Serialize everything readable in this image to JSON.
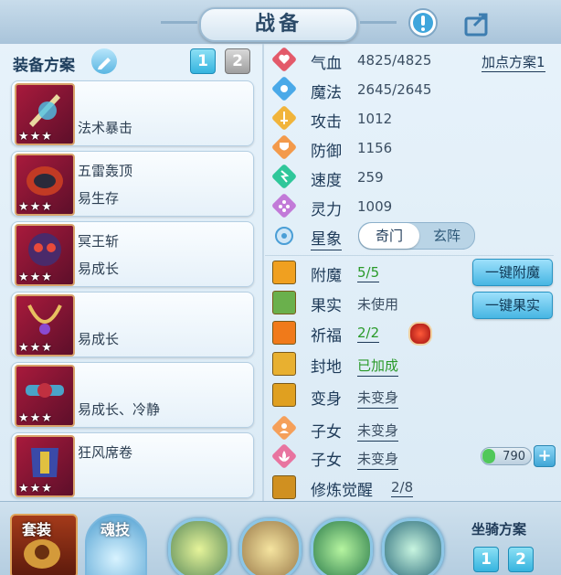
{
  "window": {
    "title": "战备"
  },
  "equipment": {
    "plan_label": "装备方案",
    "plan_buttons": [
      "1",
      "2"
    ],
    "items": [
      {
        "line1": "",
        "line2": "法术暴击",
        "stars": "★★★"
      },
      {
        "line1": "五雷轰顶",
        "line2": "易生存",
        "stars": "★★★"
      },
      {
        "line1": "冥王斩",
        "line2": "易成长",
        "stars": "★★★"
      },
      {
        "line1": "",
        "line2": "易成长",
        "stars": "★★★"
      },
      {
        "line1": "",
        "line2": "易成长、冷静",
        "stars": "★★★"
      },
      {
        "line1": "狂风席卷",
        "line2": "",
        "stars": "★★★"
      }
    ]
  },
  "stats": {
    "points_plan": "加点方案1",
    "items": [
      {
        "label": "气血",
        "value": "4825/4825",
        "icon": "heart-icon",
        "color": "#e35a6a"
      },
      {
        "label": "魔法",
        "value": "2645/2645",
        "icon": "mana-icon",
        "color": "#4aa9e8"
      },
      {
        "label": "攻击",
        "value": "1012",
        "icon": "sword-icon",
        "color": "#f1b43b"
      },
      {
        "label": "防御",
        "value": "1156",
        "icon": "shield-icon",
        "color": "#f39a4b"
      },
      {
        "label": "速度",
        "value": "259",
        "icon": "speed-icon",
        "color": "#2fc79a"
      },
      {
        "label": "灵力",
        "value": "1009",
        "icon": "spirit-icon",
        "color": "#c27ad8"
      }
    ],
    "star_label": "星象",
    "star_options": [
      "奇门",
      "玄阵"
    ]
  },
  "enhance": {
    "rows": [
      {
        "label": "附魔",
        "value": "5/5",
        "icon": "enchant-icon",
        "color": "#f0a020"
      },
      {
        "label": "果实",
        "value": "未使用",
        "icon": "fruit-icon",
        "color": "#6ab04c"
      },
      {
        "label": "祈福",
        "value": "2/2",
        "icon": "blessing-icon",
        "color": "#f07a1a"
      },
      {
        "label": "封地",
        "value": "已加成",
        "icon": "fief-icon",
        "color": "#e8b030"
      },
      {
        "label": "变身",
        "value": "未变身",
        "icon": "transform-icon",
        "color": "#e0a020"
      },
      {
        "label": "子女",
        "value": "未变身",
        "icon": "child-icon",
        "color": "#f5a05a"
      },
      {
        "label": "子女",
        "value": "未变身",
        "icon": "lotus-icon",
        "color": "#e874a0"
      },
      {
        "label": "修炼觉醒",
        "value": "2/8",
        "icon": "cultivation-icon",
        "color": "#d09020"
      }
    ],
    "enchant_button": "一键附魔",
    "fruit_button": "一键果实",
    "counter": "790",
    "plus": "+"
  },
  "bottom": {
    "set_label": "套装",
    "soul_label": "魂技",
    "mount_label": "坐骑方案",
    "mount_buttons": [
      "1",
      "2"
    ]
  },
  "colors": {
    "accent": "#3fb0de",
    "green_value": "#2a9a2a",
    "title_text": "#2b4a68"
  }
}
